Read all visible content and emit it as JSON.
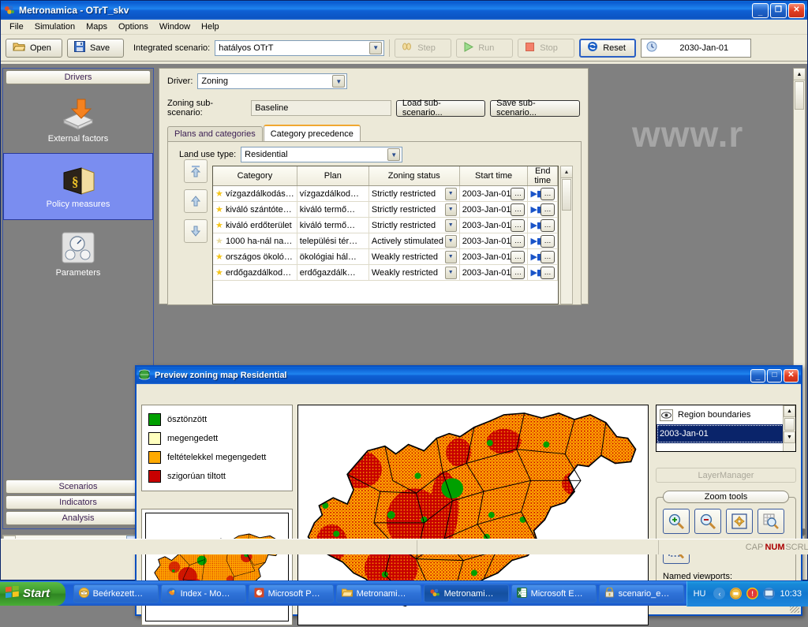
{
  "window": {
    "title": "Metronamica - OTrT_skv",
    "icon": "metronamica-icon",
    "minimize": "_",
    "maximize": "❐",
    "close": "✕"
  },
  "menubar": {
    "items": [
      "File",
      "Simulation",
      "Maps",
      "Options",
      "Window",
      "Help"
    ]
  },
  "toolbar": {
    "open_label": "Open",
    "save_label": "Save",
    "scenario_label": "Integrated scenario:",
    "scenario_value": "hatályos OTrT",
    "step_label": "Step",
    "run_label": "Run",
    "stop_label": "Stop",
    "reset_label": "Reset",
    "date_value": "2030-Jan-01"
  },
  "sidebar": {
    "header": "Drivers",
    "items": [
      {
        "label": "External factors",
        "icon": "external-factors-icon",
        "selected": false
      },
      {
        "label": "Policy measures",
        "icon": "policy-measures-icon",
        "selected": true
      },
      {
        "label": "Parameters",
        "icon": "parameters-icon",
        "selected": false
      }
    ],
    "footer_items": [
      "Scenarios",
      "Indicators",
      "Analysis"
    ]
  },
  "panel": {
    "driver_label": "Driver:",
    "driver_value": "Zoning",
    "subscenario_label": "Zoning sub-scenario:",
    "subscenario_value": "Baseline",
    "load_button": "Load sub-scenario...",
    "save_button": "Save sub-scenario...",
    "tabs": [
      {
        "label": "Plans and categories",
        "active": false
      },
      {
        "label": "Category precedence",
        "active": true
      }
    ],
    "landuse_label": "Land use type:",
    "landuse_value": "Residential",
    "table": {
      "columns": [
        "Category",
        "Plan",
        "Zoning status",
        "Start time",
        "End time"
      ],
      "rows": [
        {
          "category": "vízgazdálkodás…",
          "plan": "vízgazdálkod…",
          "status": "Strictly restricted",
          "start": "2003-Jan-01",
          "dim": false
        },
        {
          "category": "kiváló szántóte…",
          "plan": "kiváló termő…",
          "status": "Strictly restricted",
          "start": "2003-Jan-01",
          "dim": false
        },
        {
          "category": "kiváló erdőterület",
          "plan": "kiváló termő…",
          "status": "Strictly restricted",
          "start": "2003-Jan-01",
          "dim": false
        },
        {
          "category": "1000 ha-nál na…",
          "plan": "települési tér…",
          "status": "Actively stimulated",
          "start": "2003-Jan-01",
          "dim": true
        },
        {
          "category": "országos ökoló…",
          "plan": "ökológiai hál…",
          "status": "Weakly restricted",
          "start": "2003-Jan-01",
          "dim": false
        },
        {
          "category": "erdőgazdálkod…",
          "plan": "erdőgazdálk…",
          "status": "Weakly restricted",
          "start": "2003-Jan-01",
          "dim": false
        }
      ],
      "dots_label": "…"
    },
    "watermark": "www.r"
  },
  "preview": {
    "title": "Preview zoning map Residential",
    "minimize": "_",
    "maximize": "□",
    "close": "✕",
    "legend": [
      {
        "label": "ösztönzött",
        "color": "#00a000"
      },
      {
        "label": "megengedett",
        "color": "#ffffbe"
      },
      {
        "label": "feltételekkel megengedett",
        "color": "#ffaa00"
      },
      {
        "label": "szigorúan tiltott",
        "color": "#c80000"
      }
    ],
    "layers": {
      "items": [
        {
          "label": "Region boundaries",
          "selected": false,
          "icon": "eye-icon"
        },
        {
          "label": "2003-Jan-01",
          "selected": true,
          "icon": "none"
        }
      ],
      "layermanager_button": "LayerManager"
    },
    "zoom_tools": {
      "title": "Zoom tools",
      "buttons": [
        "zoom-in-icon",
        "zoom-out-icon",
        "zoom-full-extent-icon",
        "zoom-to-grid-icon",
        "zoom-to-rectangle-icon"
      ],
      "viewports_label": "Named viewports:",
      "viewports_value": ""
    }
  },
  "statusbar": {
    "message": "",
    "indicators": [
      {
        "label": "CAP",
        "on": false
      },
      {
        "label": "NUM",
        "on": true
      },
      {
        "label": "SCRL",
        "on": false
      }
    ]
  },
  "taskbar": {
    "start_label": "Start",
    "buttons": [
      {
        "label": "Beérkezett…",
        "icon": "mail-icon",
        "active": false
      },
      {
        "label": "Index - Mo…",
        "icon": "firefox-icon",
        "active": false
      },
      {
        "label": "Microsoft P…",
        "icon": "powerpoint-icon",
        "active": false
      },
      {
        "label": "Metronami…",
        "icon": "folder-icon",
        "active": false
      },
      {
        "label": "Metronami…",
        "icon": "metronamica-icon",
        "active": true
      },
      {
        "label": "Microsoft E…",
        "icon": "excel-icon",
        "active": false
      },
      {
        "label": "scenario_e…",
        "icon": "winzip-icon",
        "active": false
      }
    ],
    "language": "HU",
    "tray_icons": [
      "back-arrow-icon",
      "shield-icon",
      "warning-icon",
      "screen-icon"
    ],
    "clock": "10:33"
  },
  "map": {
    "alt": "Zoning map of Hungary",
    "background": "#ffffff",
    "colors": {
      "permitted": "#ffaa00",
      "restricted": "#c80000",
      "stimulated": "#00a000"
    }
  },
  "colors": {
    "titlebar_blue": "#0a5bd0",
    "window_face": "#ece9d8",
    "nav_bg": "#808080",
    "selection_blue": "#7a8df0"
  }
}
